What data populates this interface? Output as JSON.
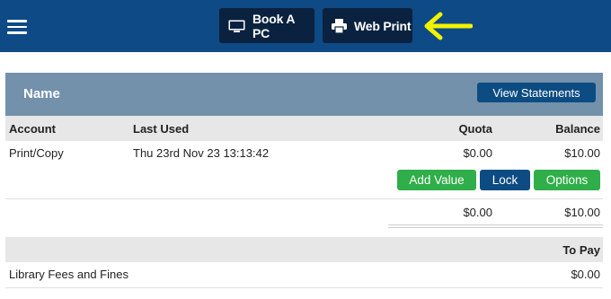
{
  "nav": {
    "book_pc": "Book A PC",
    "web_print": "Web Print"
  },
  "colors": {
    "topbar": "#0e4a85",
    "nav_button": "#0a2240",
    "section_header": "#7391ab",
    "primary_button": "#0c4c82",
    "success_button": "#2fae49",
    "arrow": "#f2f200"
  },
  "account_section": {
    "title": "Name",
    "view_statements": "View Statements",
    "columns": {
      "account": "Account",
      "last_used": "Last Used",
      "quota": "Quota",
      "balance": "Balance"
    },
    "rows": [
      {
        "account": "Print/Copy",
        "last_used": "Thu 23rd Nov 23 13:13:42",
        "quota": "$0.00",
        "balance": "$10.00"
      }
    ],
    "actions": {
      "add_value": "Add Value",
      "lock": "Lock",
      "options": "Options"
    },
    "totals": {
      "quota": "$0.00",
      "balance": "$10.00"
    }
  },
  "fees_section": {
    "header": "To Pay",
    "rows": [
      {
        "label": "Library Fees and Fines",
        "amount": "$0.00"
      }
    ]
  }
}
